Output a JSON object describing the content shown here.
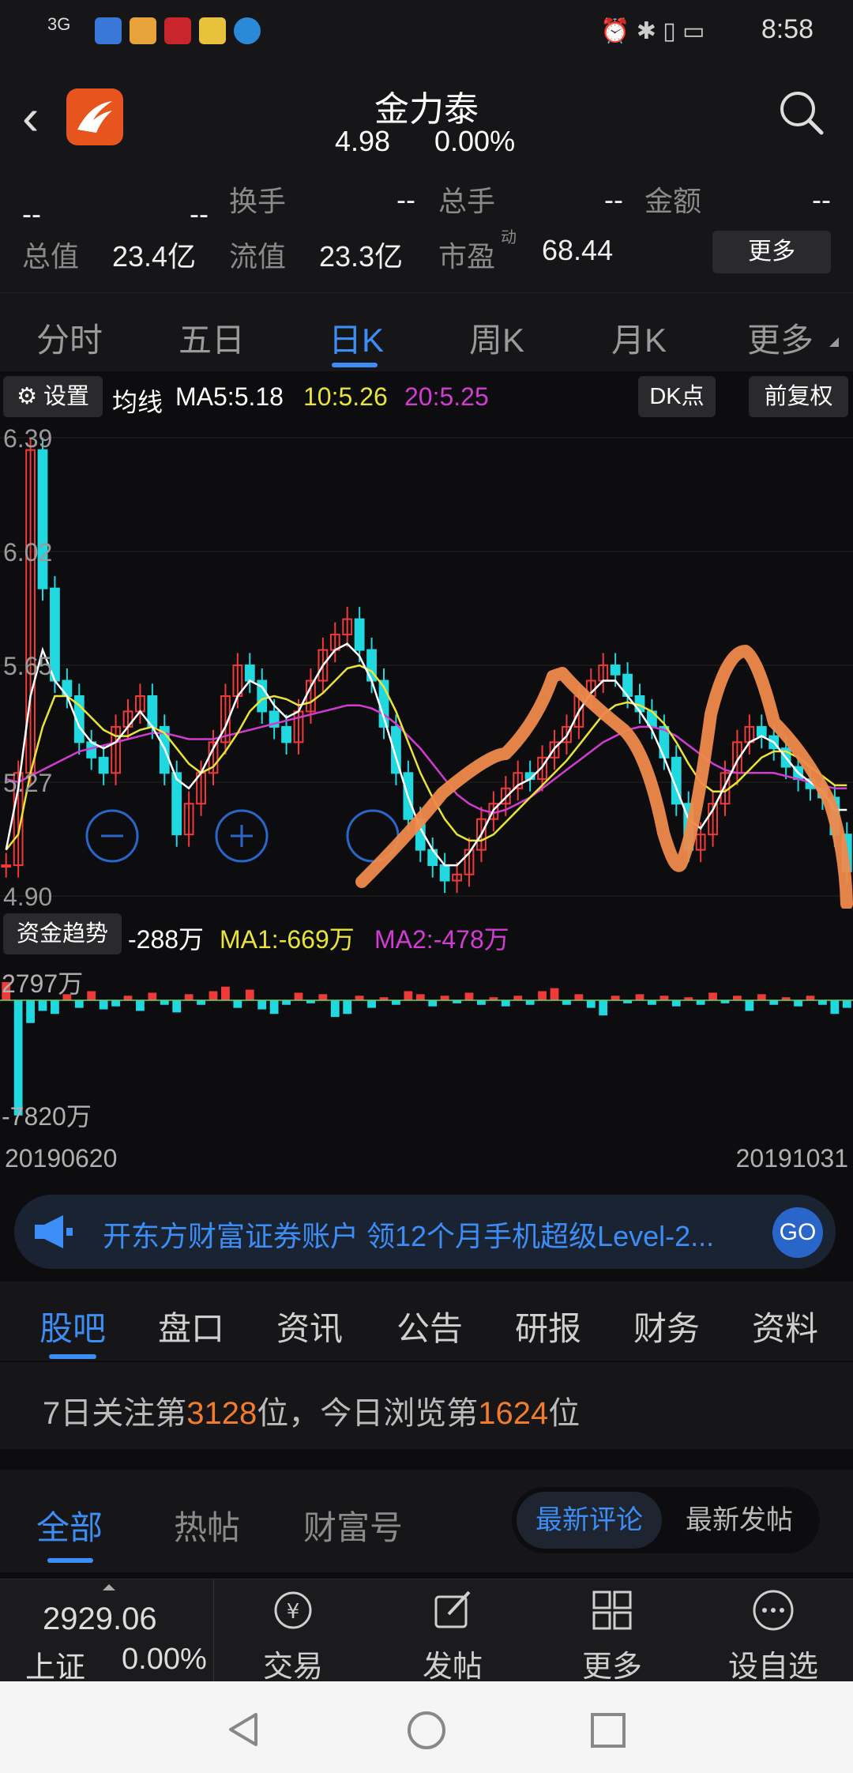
{
  "status": {
    "signal": "3G",
    "time": "8:58"
  },
  "header": {
    "title": "金力泰",
    "price": "4.98",
    "change_pct": "0.00%"
  },
  "quote": {
    "r1c1_l": "--",
    "r1c1_r": "--",
    "turnover_label": "换手",
    "turnover_value": "--",
    "volume_label": "总手",
    "volume_value": "--",
    "amount_label": "金额",
    "amount_value": "--",
    "total_mv_label": "总值",
    "total_mv_value": "23.4亿",
    "float_mv_label": "流值",
    "float_mv_value": "23.3亿",
    "pe_label": "市盈",
    "pe_sup": "动",
    "pe_value": "68.44",
    "more_label": "更多"
  },
  "tabs": [
    "分时",
    "五日",
    "日K",
    "周K",
    "月K",
    "更多"
  ],
  "indicator": {
    "settings_label": "设置",
    "ma_label": "均线",
    "ma5": "MA5:5.18",
    "ma10": "10:5.26",
    "ma20": "20:5.25",
    "dk_label": "DK点",
    "adjust_label": "前复权"
  },
  "colors": {
    "up": "#f03a3a",
    "down": "#20d8e0",
    "ma5": "#ffffff",
    "ma10": "#e8e43a",
    "ma20": "#d23cd2",
    "accent": "#3c8df5",
    "scribble": "#f08a4b"
  },
  "chart_data": {
    "type": "candlestick",
    "y_ticks": [
      "6.39",
      "6.02",
      "5.65",
      "5.27",
      "4.90"
    ],
    "ylim": [
      4.9,
      6.39
    ],
    "x_start": "20190620",
    "x_end": "20191031",
    "close": [
      5.0,
      5.3,
      6.35,
      5.9,
      5.6,
      5.55,
      5.4,
      5.35,
      5.3,
      5.45,
      5.5,
      5.55,
      5.45,
      5.3,
      5.1,
      5.2,
      5.3,
      5.4,
      5.55,
      5.65,
      5.6,
      5.5,
      5.45,
      5.4,
      5.5,
      5.6,
      5.7,
      5.75,
      5.8,
      5.7,
      5.6,
      5.45,
      5.3,
      5.15,
      5.05,
      5.0,
      4.95,
      4.97,
      5.05,
      5.15,
      5.2,
      5.25,
      5.3,
      5.28,
      5.35,
      5.4,
      5.45,
      5.55,
      5.6,
      5.65,
      5.62,
      5.55,
      5.5,
      5.45,
      5.35,
      5.2,
      5.05,
      5.1,
      5.2,
      5.3,
      5.4,
      5.45,
      5.42,
      5.38,
      5.32,
      5.28,
      5.25,
      5.22,
      5.1,
      4.98
    ],
    "ma": {
      "ma5": [
        5.05,
        5.25,
        5.55,
        5.7,
        5.6,
        5.55,
        5.45,
        5.4,
        5.38,
        5.4,
        5.45,
        5.5,
        5.45,
        5.38,
        5.28,
        5.25,
        5.3,
        5.38,
        5.45,
        5.55,
        5.6,
        5.58,
        5.52,
        5.48,
        5.5,
        5.58,
        5.65,
        5.7,
        5.72,
        5.68,
        5.6,
        5.48,
        5.35,
        5.22,
        5.12,
        5.05,
        5.0,
        5.0,
        5.04,
        5.1,
        5.18,
        5.22,
        5.26,
        5.28,
        5.32,
        5.38,
        5.42,
        5.5,
        5.56,
        5.6,
        5.6,
        5.55,
        5.5,
        5.44,
        5.35,
        5.25,
        5.15,
        5.12,
        5.18,
        5.26,
        5.34,
        5.4,
        5.42,
        5.4,
        5.35,
        5.3,
        5.27,
        5.24,
        5.18,
        5.18
      ],
      "ma10": [
        5.05,
        5.1,
        5.3,
        5.45,
        5.55,
        5.55,
        5.52,
        5.48,
        5.44,
        5.42,
        5.42,
        5.44,
        5.45,
        5.43,
        5.38,
        5.33,
        5.3,
        5.32,
        5.37,
        5.43,
        5.5,
        5.54,
        5.55,
        5.54,
        5.52,
        5.53,
        5.56,
        5.6,
        5.64,
        5.65,
        5.63,
        5.58,
        5.5,
        5.4,
        5.3,
        5.22,
        5.15,
        5.1,
        5.08,
        5.08,
        5.1,
        5.14,
        5.18,
        5.22,
        5.26,
        5.3,
        5.34,
        5.39,
        5.44,
        5.49,
        5.52,
        5.53,
        5.52,
        5.5,
        5.46,
        5.4,
        5.33,
        5.27,
        5.24,
        5.24,
        5.27,
        5.31,
        5.35,
        5.37,
        5.37,
        5.35,
        5.32,
        5.29,
        5.26,
        5.26
      ],
      "ma20": [
        5.28,
        5.27,
        5.29,
        5.31,
        5.33,
        5.35,
        5.37,
        5.38,
        5.39,
        5.4,
        5.41,
        5.42,
        5.43,
        5.43,
        5.42,
        5.41,
        5.41,
        5.41,
        5.42,
        5.43,
        5.44,
        5.45,
        5.46,
        5.47,
        5.48,
        5.49,
        5.5,
        5.51,
        5.52,
        5.52,
        5.51,
        5.49,
        5.46,
        5.42,
        5.38,
        5.33,
        5.28,
        5.23,
        5.2,
        5.18,
        5.17,
        5.18,
        5.2,
        5.22,
        5.25,
        5.28,
        5.31,
        5.34,
        5.37,
        5.4,
        5.42,
        5.44,
        5.45,
        5.45,
        5.44,
        5.42,
        5.39,
        5.36,
        5.33,
        5.31,
        5.3,
        5.3,
        5.3,
        5.3,
        5.29,
        5.28,
        5.27,
        5.26,
        5.25,
        5.25
      ]
    }
  },
  "fund": {
    "label": "资金趋势",
    "value": "-288万",
    "ma1": "MA1:-669万",
    "ma2": "MA2:-478万",
    "top_tick": "2797万",
    "bottom_tick": "-7820万",
    "flows": [
      1200,
      -7600,
      -1500,
      -700,
      -900,
      400,
      -500,
      600,
      -600,
      -400,
      300,
      -700,
      500,
      -300,
      -800,
      400,
      -300,
      600,
      900,
      -500,
      700,
      -600,
      -900,
      -300,
      500,
      -200,
      400,
      -1100,
      -900,
      300,
      -500,
      200,
      -300,
      600,
      400,
      -400,
      300,
      -200,
      500,
      -300,
      200,
      -400,
      300,
      -300,
      600,
      800,
      -300,
      400,
      -500,
      -1000,
      300,
      -200,
      400,
      -300,
      300,
      -400,
      200,
      -300,
      500,
      -200,
      300,
      -700,
      400,
      -300,
      200,
      -400,
      300,
      -300,
      -900,
      -500
    ]
  },
  "ad": {
    "text": "开东方财富证券账户 领12个月手机超级Level-2...",
    "go": "GO"
  },
  "section_tabs": [
    "股吧",
    "盘口",
    "资讯",
    "公告",
    "研报",
    "财务",
    "资料"
  ],
  "rank": {
    "p1": "7日关注第",
    "n1": "3128",
    "p2": "位，今日浏览第",
    "n2": "1624",
    "p3": "位"
  },
  "filter": {
    "tabs": [
      "全部",
      "热帖",
      "财富号"
    ],
    "seg_a": "最新评论",
    "seg_b": "最新发帖"
  },
  "toolbar": {
    "index_value": "2929.06",
    "index_name": "上证",
    "index_pct": "0.00%",
    "items": [
      "交易",
      "发帖",
      "更多",
      "设自选"
    ]
  }
}
